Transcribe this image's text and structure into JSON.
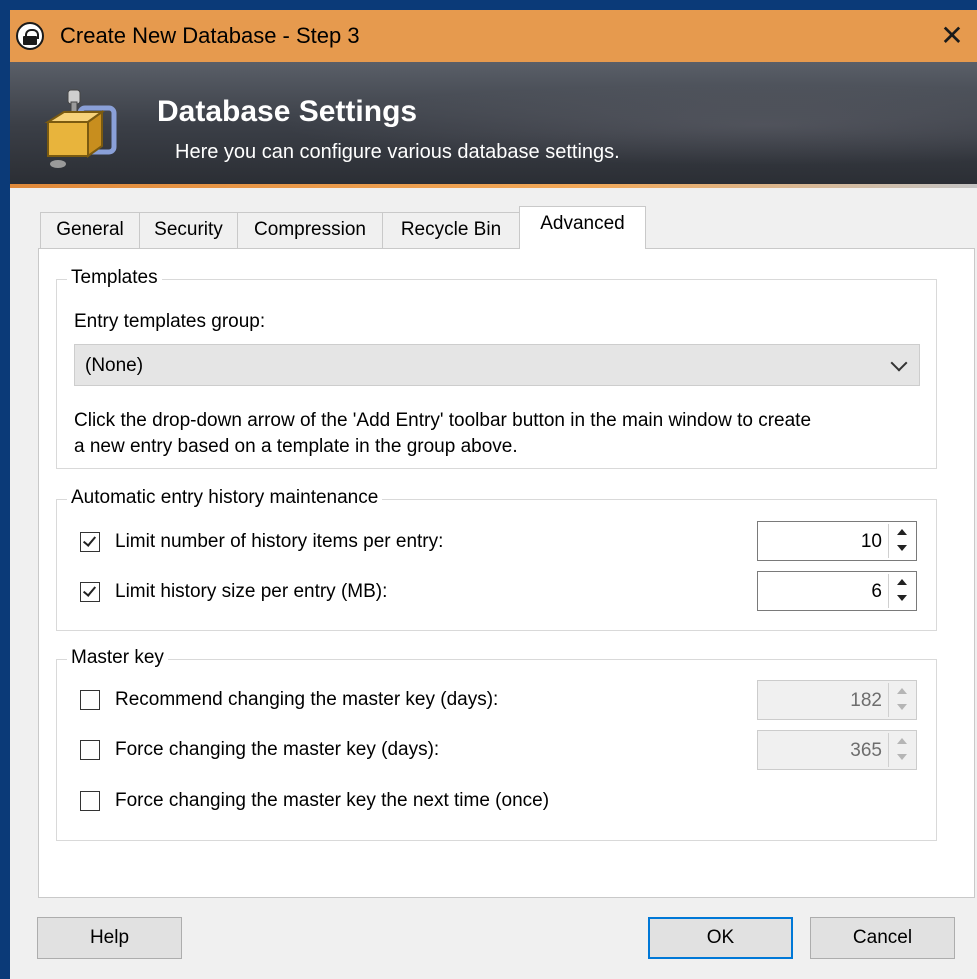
{
  "window": {
    "title": "Create New Database - Step 3",
    "title_icon": "lock-icon",
    "close_icon": "close-icon",
    "close_glyph": "✕"
  },
  "banner": {
    "title": "Database Settings",
    "subtitle": "Here you can configure various database settings.",
    "icon": "database-settings-icon"
  },
  "tabs": [
    {
      "label": "General",
      "active": false
    },
    {
      "label": "Security",
      "active": false
    },
    {
      "label": "Compression",
      "active": false
    },
    {
      "label": "Recycle Bin",
      "active": false
    },
    {
      "label": "Advanced",
      "active": true
    }
  ],
  "templates": {
    "group_label": "Templates",
    "field_label": "Entry templates group:",
    "selected": "(None)",
    "help_line1": "Click the drop-down arrow of the 'Add Entry' toolbar button in the main window to create",
    "help_line2": "a new entry based on a template in the group above."
  },
  "history": {
    "group_label": "Automatic entry history maintenance",
    "items": [
      {
        "label": "Limit number of history items per entry:",
        "checked": true,
        "value": "10",
        "enabled": true
      },
      {
        "label": "Limit history size per entry (MB):",
        "checked": true,
        "value": "6",
        "enabled": true
      }
    ]
  },
  "master_key": {
    "group_label": "Master key",
    "items": [
      {
        "label": "Recommend changing the master key (days):",
        "checked": false,
        "value": "182",
        "enabled": false
      },
      {
        "label": "Force changing the master key (days):",
        "checked": false,
        "value": "365",
        "enabled": false
      },
      {
        "label": "Force changing the master key the next time (once)",
        "checked": false
      }
    ]
  },
  "buttons": {
    "help": "Help",
    "ok": "OK",
    "cancel": "Cancel"
  },
  "colors": {
    "titlebar": "#e69a4e",
    "accent": "#0078d7",
    "desktop": "#0b3a78"
  }
}
